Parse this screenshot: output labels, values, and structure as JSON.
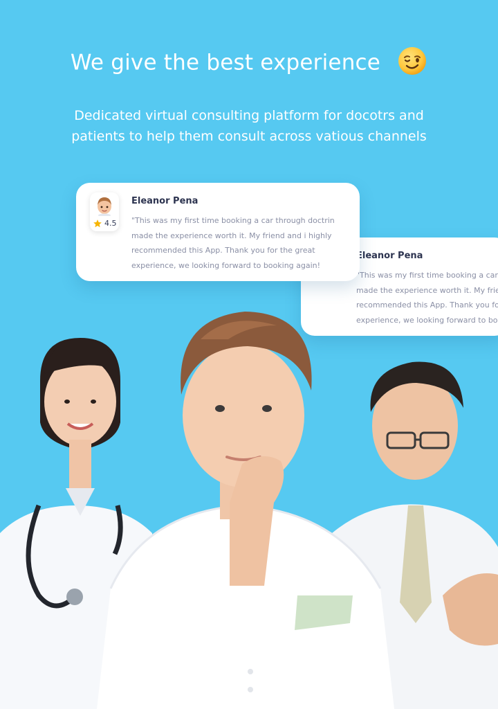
{
  "hero": {
    "title": "We give the best experience",
    "subtitle_line1": "Dedicated virtual consulting platform for docotrs and",
    "subtitle_line2": "patients to help them consult across vatious channels",
    "emoji_icon": "winking-face-icon"
  },
  "reviews": [
    {
      "name": "Eleanor Pena",
      "rating": "4.5",
      "avatar_icon": "avatar-memoji-icon",
      "text_lines": [
        "\"This was my first time booking a car through doctrin",
        "made the experience worth it. My friend and i highly",
        "recommended this App. Thank you for the great",
        "experience, we looking forward to booking again!"
      ]
    },
    {
      "name": "Eleanor Pena",
      "text_lines": [
        "\"This was my first time booking a car through doctrin",
        "made the experience worth it. My friend and i highly",
        "recommended this App. Thank you for the great",
        "experience, we looking forward to booking again!"
      ]
    }
  ],
  "colors": {
    "background": "#56c9f1",
    "card": "#ffffff",
    "name": "#2d3450",
    "body_text": "#8a8fa5",
    "star": "#f7b500"
  }
}
